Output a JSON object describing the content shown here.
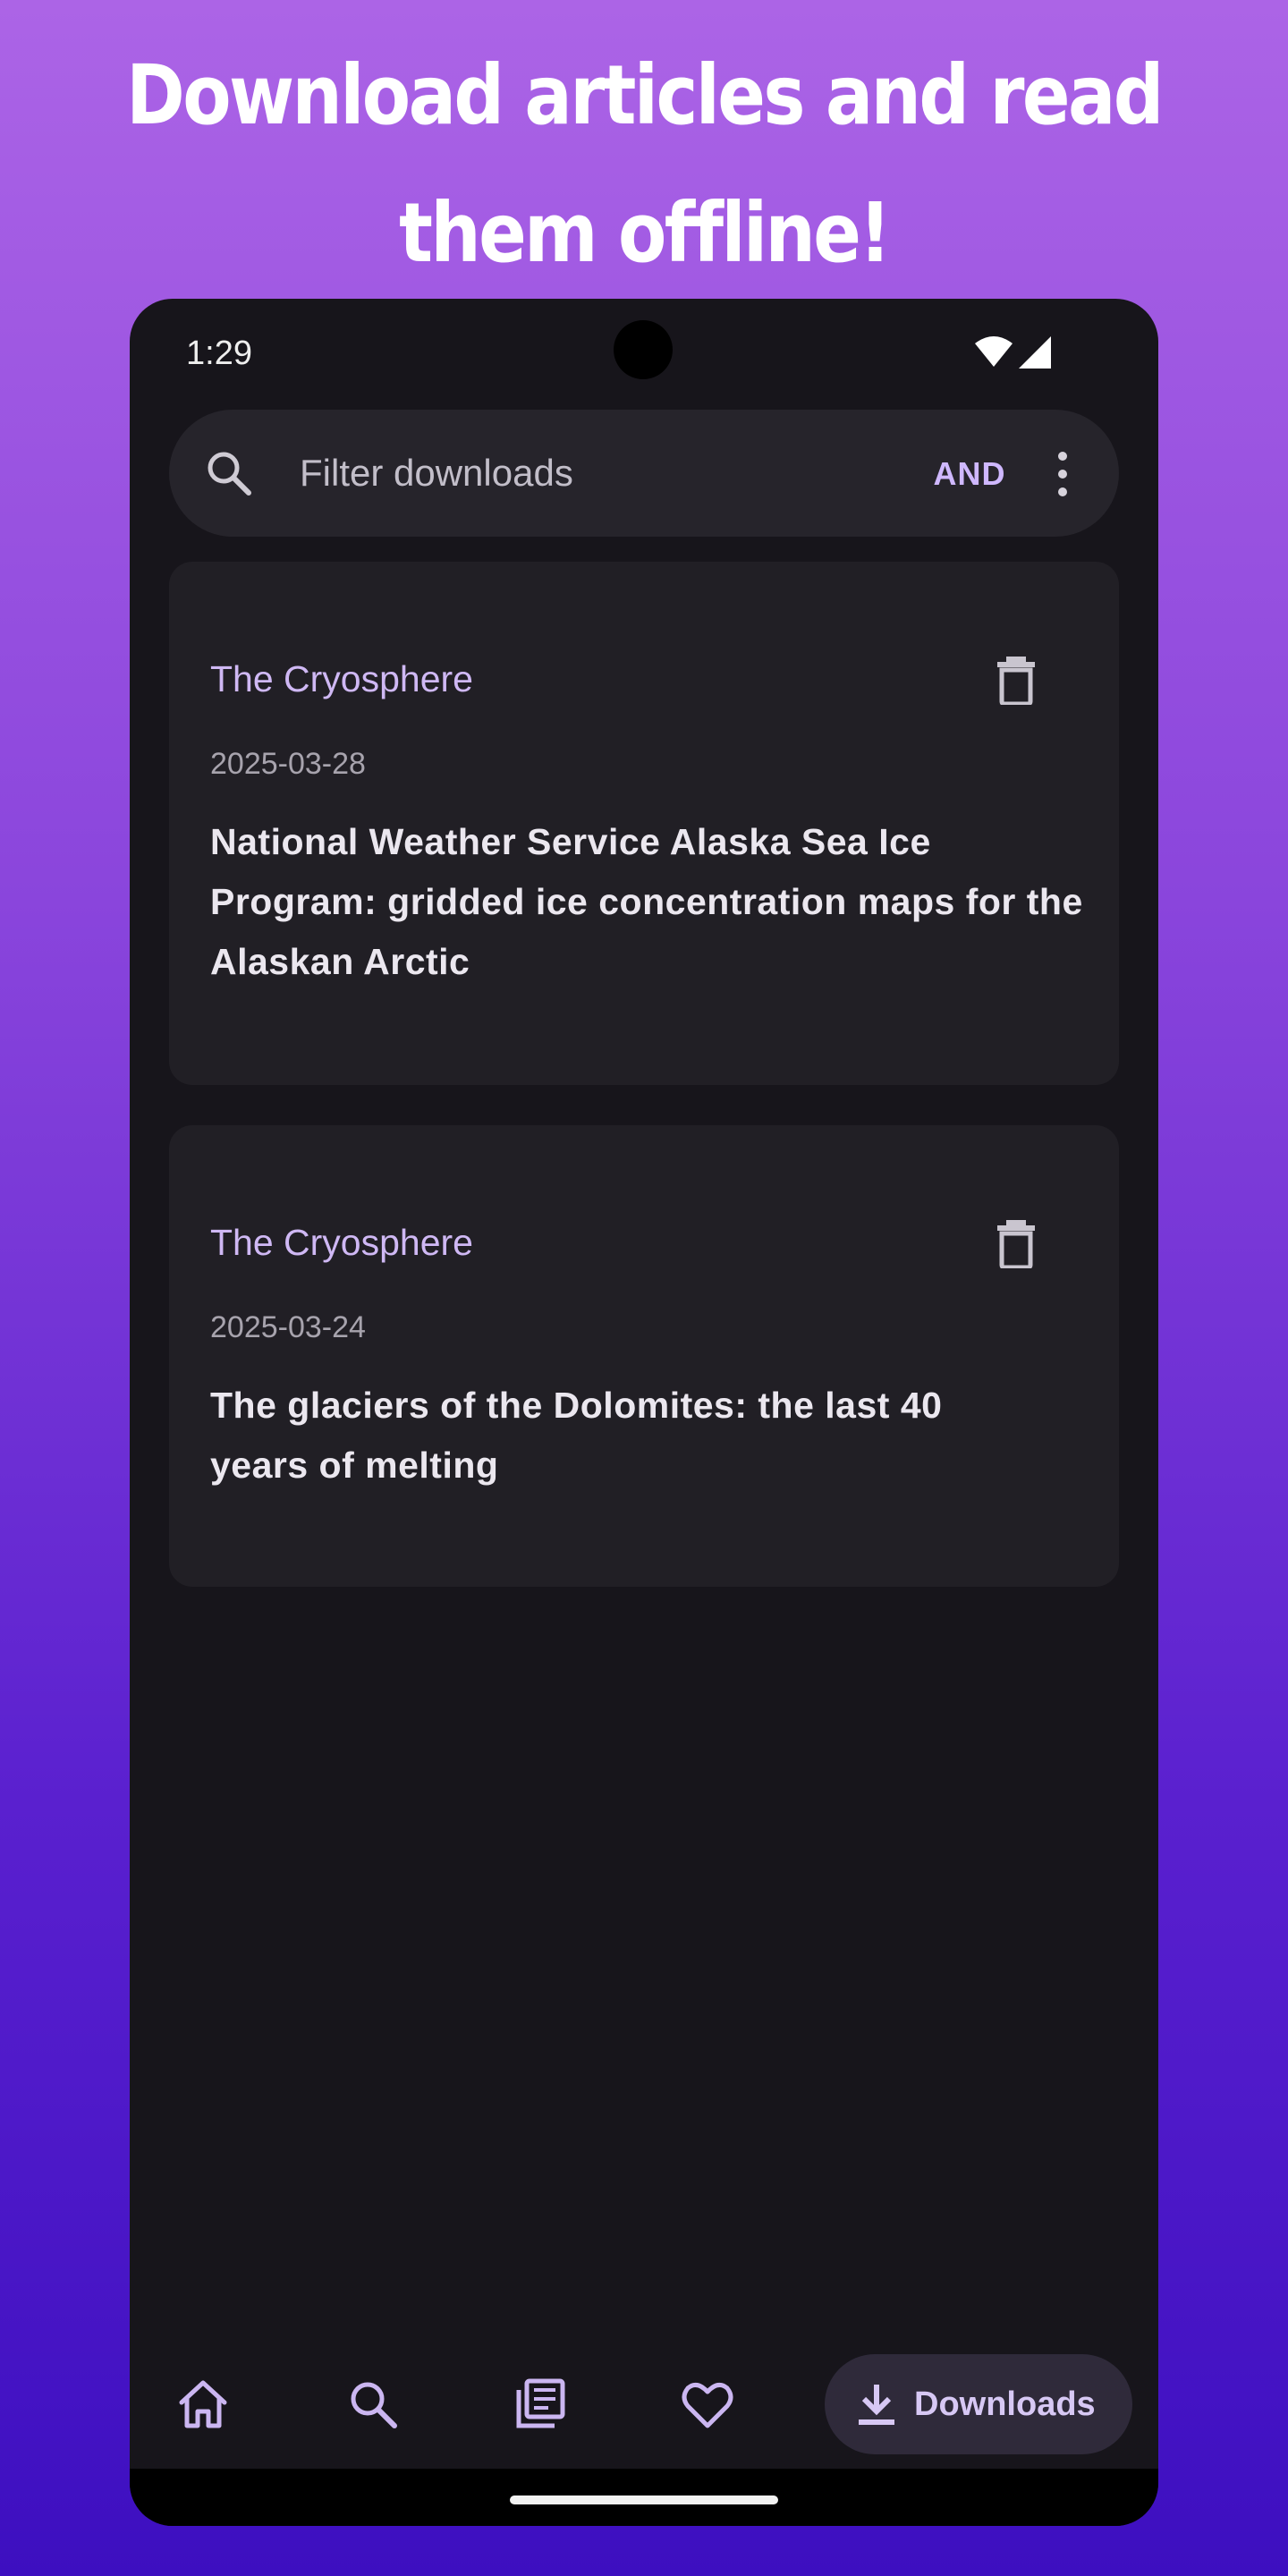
{
  "promo": {
    "line1": "Download articles and read",
    "line2": "them offline!"
  },
  "status_bar": {
    "time": "1:29",
    "icons": [
      "wifi-icon",
      "signal-icon"
    ]
  },
  "search": {
    "placeholder": "Filter downloads",
    "value": "",
    "mode_label": "AND",
    "icons": [
      "search-icon",
      "more-vert-icon"
    ]
  },
  "downloads": [
    {
      "journal": "The Cryosphere",
      "date": "2025-03-28",
      "title": "National Weather Service Alaska Sea Ice Program: gridded ice concentration maps for the Alaskan Arctic"
    },
    {
      "journal": "The Cryosphere",
      "date": "2025-03-24",
      "title": "The glaciers of the Dolomites: the last 40 years of melting"
    }
  ],
  "bottom_nav": {
    "items": [
      "home-icon",
      "search-icon",
      "feed-icon",
      "favorites-icon"
    ],
    "active_label": "Downloads"
  },
  "colors": {
    "accent": "#cfb8f4",
    "surface": "#17151b",
    "card": "#211f25",
    "gradient_top": "#ac64e6",
    "gradient_bottom": "#3d0fc0"
  }
}
